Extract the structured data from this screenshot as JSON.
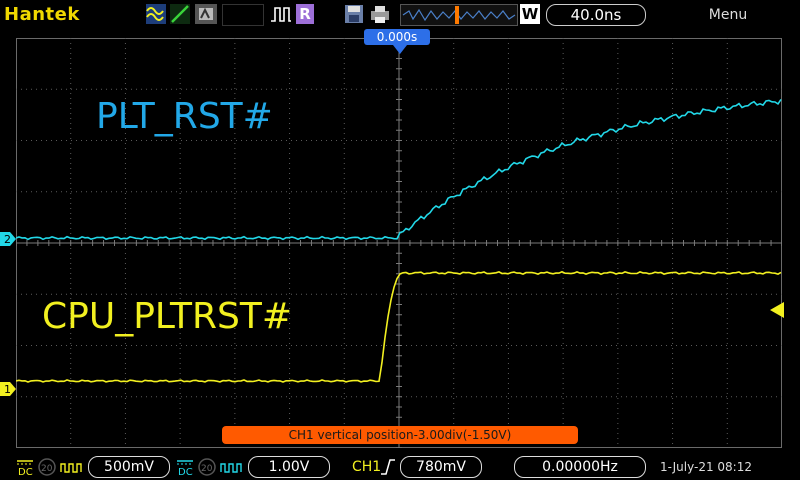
{
  "app": {
    "brand": "Hantek",
    "run_mode": "R",
    "menu_label": "Menu"
  },
  "timebase": {
    "scale": "40.0ns",
    "w_label": "W",
    "trigger_time": "0.000s"
  },
  "channels": [
    {
      "name": "CPU_PLTRST#",
      "marker": "1",
      "color": "#f2f020",
      "coupling": "DC",
      "probe": "20",
      "volts_div": "500mV"
    },
    {
      "name": "PLT_RST#",
      "marker": "2",
      "color": "#22d8e8",
      "coupling": "DC",
      "probe": "20",
      "volts_div": "1.00V"
    }
  ],
  "trigger": {
    "source": "CH1",
    "level": "780mV",
    "frequency": "0.00000Hz"
  },
  "notice": "CH1 vertical position-3.00div(-1.50V)",
  "datetime": "1-July-21 08:12",
  "colors": {
    "brand": "#f0d800",
    "ch1": "#f2f020",
    "ch2": "#22d8e8",
    "notice": "#ff5a00",
    "trigger_box": "#2d6fe8"
  },
  "icons": [
    "ac-wave-icon",
    "ramp-icon",
    "persist-icon",
    "pulse-icon",
    "save-icon",
    "print-icon",
    "trigger-marker-icon"
  ]
}
